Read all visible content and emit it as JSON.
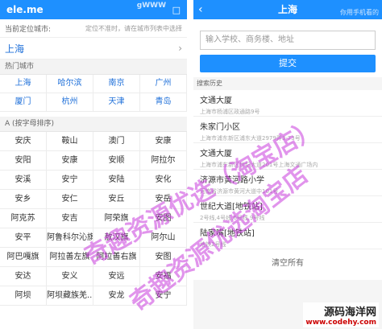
{
  "left": {
    "header": {
      "title": "ele.me",
      "watermark_text": "gWWW"
    },
    "location": {
      "label": "当前定位城市:",
      "hint": "定位不准时，请在城市列表中选择",
      "city": "上海"
    },
    "hot": {
      "label": "热门城市",
      "cities": [
        "上海",
        "哈尔滨",
        "南京",
        "广州",
        "厦门",
        "杭州",
        "天津",
        "青岛"
      ]
    },
    "alpha": {
      "label": "A  (按字母排序)",
      "cities": [
        "安庆",
        "鞍山",
        "澳门",
        "安康",
        "安阳",
        "安康",
        "安顺",
        "阿拉尔",
        "安溪",
        "安宁",
        "安陆",
        "安化",
        "安乡",
        "安仁",
        "安丘",
        "安岳",
        "阿克苏",
        "安吉",
        "阿荣旗",
        "安图",
        "安平",
        "阿鲁科尔沁旗",
        "敖汉旗",
        "阿尔山",
        "阿巴嘎旗",
        "阿拉善左旗",
        "阿拉善右旗",
        "安图",
        "安达",
        "安义",
        "安远",
        "安福",
        "阿坝",
        "阿坝藏族羌...",
        "安龙",
        "安宁"
      ]
    }
  },
  "right": {
    "header": {
      "title": "上海",
      "watermark_text": "你用手机看的"
    },
    "search": {
      "placeholder": "输入学校、商务楼、地址",
      "submit_label": "提交"
    },
    "history": {
      "label": "搜索历史",
      "items": [
        {
          "name": "文通大厦",
          "addr": "上海市杨浦区政通路9号"
        },
        {
          "name": "朱家门小区",
          "addr": "上海市浦东新区浦东大道2979弄3-73号"
        },
        {
          "name": "文通大厦",
          "addr": "上海市浦东新区世纪大道201号上海文通广场内"
        },
        {
          "name": "济源市黄河路小学",
          "addr": "河南省济源市黄河大道中101号"
        },
        {
          "name": "世纪大道[地铁站]",
          "addr": "2号线,4号线,6号线,9号线"
        },
        {
          "name": "陆家嘴[地铁站]",
          "addr": "地铁2号线"
        }
      ],
      "clear_label": "清空所有"
    }
  },
  "overlay": {
    "watermark_a": "奇趣资源优选（淘宝店）",
    "watermark_b": "奇趣资源优选淘宝店",
    "brand_line1": "源码海洋网",
    "brand_line2": "www.codehy.com"
  }
}
